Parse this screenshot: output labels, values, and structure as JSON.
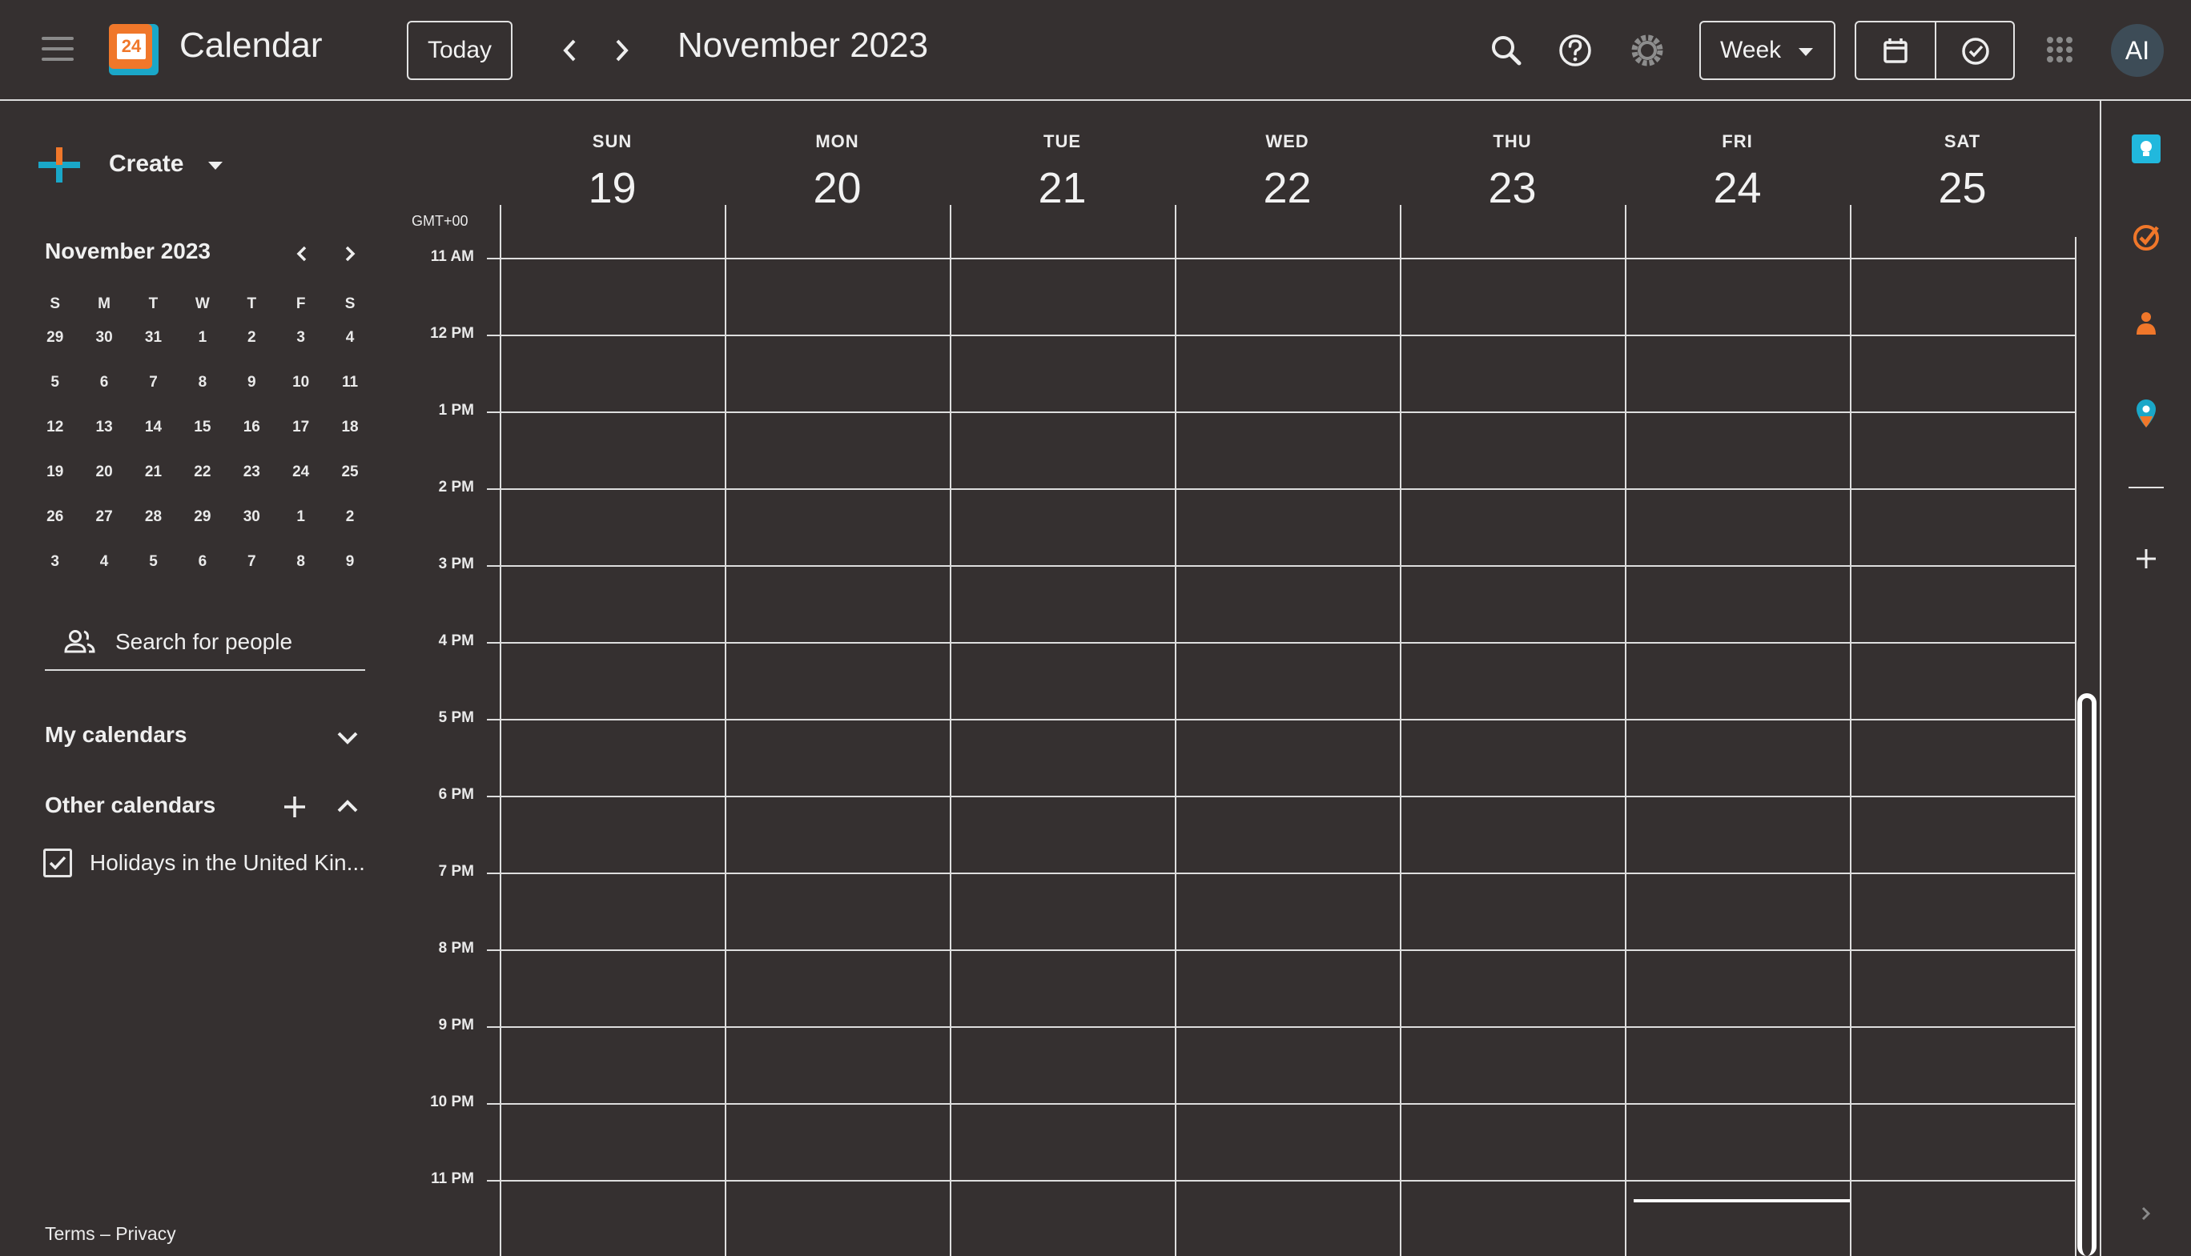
{
  "header": {
    "app_title": "Calendar",
    "logo_day": "24",
    "today_label": "Today",
    "month_title": "November 2023",
    "view_label": "Week",
    "avatar_initials": "AI"
  },
  "sidebar": {
    "create_label": "Create",
    "mini_calendar": {
      "title": "November 2023",
      "weekday_headers": [
        "S",
        "M",
        "T",
        "W",
        "T",
        "F",
        "S"
      ],
      "weeks": [
        [
          "29",
          "30",
          "31",
          "1",
          "2",
          "3",
          "4"
        ],
        [
          "5",
          "6",
          "7",
          "8",
          "9",
          "10",
          "11"
        ],
        [
          "12",
          "13",
          "14",
          "15",
          "16",
          "17",
          "18"
        ],
        [
          "19",
          "20",
          "21",
          "22",
          "23",
          "24",
          "25"
        ],
        [
          "26",
          "27",
          "28",
          "29",
          "30",
          "1",
          "2"
        ],
        [
          "3",
          "4",
          "5",
          "6",
          "7",
          "8",
          "9"
        ]
      ]
    },
    "search_people_placeholder": "Search for people",
    "my_calendars_label": "My calendars",
    "other_calendars_label": "Other calendars",
    "other_calendar_items": [
      "Holidays in the United Kin..."
    ],
    "footer": {
      "terms": "Terms",
      "separator": "–",
      "privacy": "Privacy"
    }
  },
  "week_view": {
    "timezone": "GMT+00",
    "days": [
      {
        "name": "SUN",
        "number": "19"
      },
      {
        "name": "MON",
        "number": "20"
      },
      {
        "name": "TUE",
        "number": "21"
      },
      {
        "name": "WED",
        "number": "22"
      },
      {
        "name": "THU",
        "number": "23"
      },
      {
        "name": "FRI",
        "number": "24"
      },
      {
        "name": "SAT",
        "number": "25"
      }
    ],
    "hours": [
      "11 AM",
      "12 PM",
      "1 PM",
      "2 PM",
      "3 PM",
      "4 PM",
      "5 PM",
      "6 PM",
      "7 PM",
      "8 PM",
      "9 PM",
      "10 PM",
      "11 PM"
    ]
  },
  "colors": {
    "background": "#353030",
    "line": "#dedede",
    "logo_orange": "#f0772a",
    "logo_blue": "#1aa7c8",
    "side_blue": "#21b8dd",
    "side_orange": "#f0772a"
  },
  "side_panel_icons": [
    "keep-icon",
    "tasks-icon",
    "contacts-icon",
    "maps-icon",
    "add-icon",
    "expand-icon"
  ]
}
